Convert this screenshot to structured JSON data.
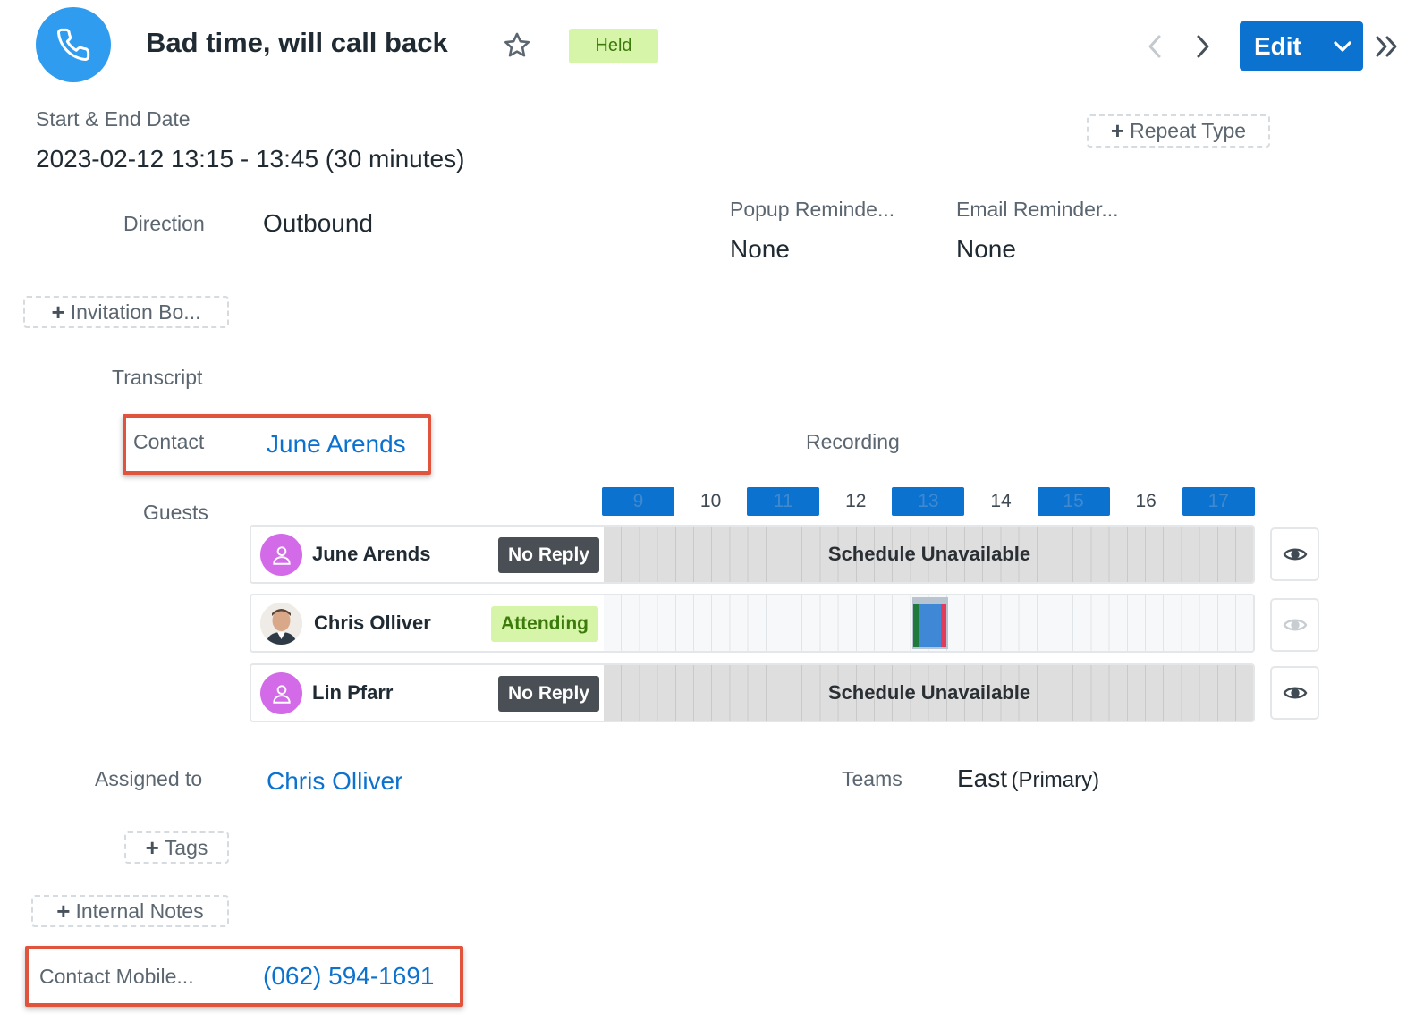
{
  "header": {
    "title": "Bad time, will call back",
    "status": "Held",
    "edit_label": "Edit"
  },
  "colors": {
    "primary": "#0b72d0",
    "call_icon_bg": "#2f9cf0",
    "held_badge_bg": "#d7f5a8",
    "highlight_border": "#e0533c",
    "avatar_purple": "#d36ae8"
  },
  "icons": {
    "record": "phone-icon",
    "favorite": "star-icon",
    "prev": "chevron-left-icon",
    "next": "chevron-right-icon",
    "actions": "chevron-down-icon",
    "panel": "double-chevron-right-icon",
    "preview": "eye-icon",
    "add": "plus-icon"
  },
  "fields": {
    "start_end": {
      "label": "Start & End Date",
      "value": "2023-02-12 13:15 - 13:45 (30 minutes)"
    },
    "repeat_type_btn": "Repeat Type",
    "direction": {
      "label": "Direction",
      "value": "Outbound"
    },
    "popup_reminder": {
      "label": "Popup Reminde...",
      "value": "None"
    },
    "email_reminder": {
      "label": "Email Reminder...",
      "value": "None"
    },
    "invitation_btn": "Invitation Bo...",
    "transcript": {
      "label": "Transcript"
    },
    "contact": {
      "label": "Contact",
      "value": "June Arends"
    },
    "recording": {
      "label": "Recording"
    },
    "guests_label": "Guests",
    "assigned_to": {
      "label": "Assigned to",
      "value": "Chris Olliver"
    },
    "teams": {
      "label": "Teams",
      "value": "East",
      "primary": "(Primary)"
    },
    "tags_btn": "Tags",
    "internal_notes_btn": "Internal Notes",
    "contact_mobile": {
      "label": "Contact Mobile...",
      "value": "(062) 594-1691"
    }
  },
  "schedule": {
    "hours": [
      "9",
      "10",
      "11",
      "12",
      "13",
      "14",
      "15",
      "16",
      "17"
    ],
    "highlighted_hours": [
      "9",
      "11",
      "13",
      "15",
      "17"
    ],
    "guests": [
      {
        "name": "June Arends",
        "reply": "No Reply",
        "avatar": "person-icon",
        "timeline": "Schedule Unavailable"
      },
      {
        "name": "Chris Olliver",
        "reply": "Attending",
        "avatar": "user-photo",
        "timeline": ""
      },
      {
        "name": "Lin Pfarr",
        "reply": "No Reply",
        "avatar": "person-icon",
        "timeline": "Schedule Unavailable"
      }
    ]
  }
}
